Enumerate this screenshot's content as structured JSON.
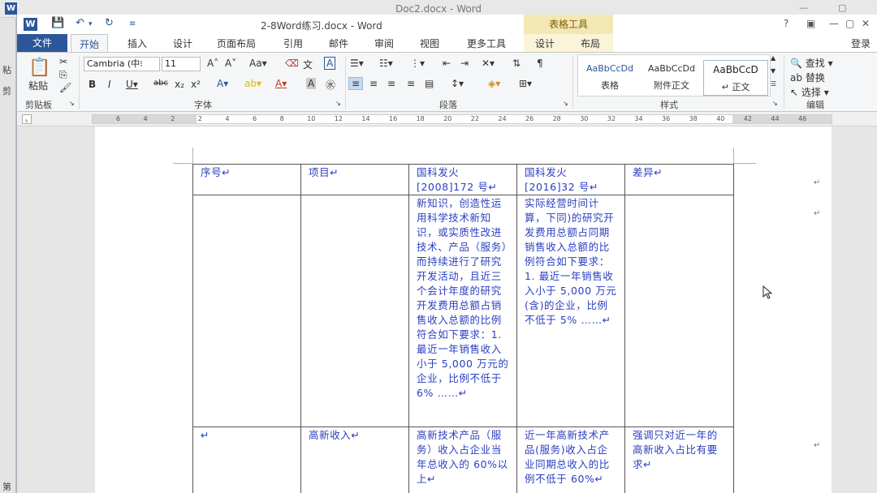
{
  "background_window": {
    "title": "Doc2.docx - Word",
    "logo": "W",
    "left_strip_chars": [
      "粘",
      "剪",
      "第"
    ]
  },
  "window": {
    "title": "2-8Word练习.docx - Word",
    "logo": "W",
    "context_tab_group": "表格工具",
    "controls": [
      "?",
      "▣",
      "—",
      "▢",
      "✕"
    ],
    "login": "登录"
  },
  "tabs": [
    {
      "label": "文件",
      "type": "file"
    },
    {
      "label": "开始",
      "type": "active"
    },
    {
      "label": "插入"
    },
    {
      "label": "设计"
    },
    {
      "label": "页面布局"
    },
    {
      "label": "引用"
    },
    {
      "label": "邮件"
    },
    {
      "label": "审阅"
    },
    {
      "label": "视图"
    },
    {
      "label": "更多工具"
    },
    {
      "label": "设计",
      "type": "context"
    },
    {
      "label": "布局",
      "type": "context"
    }
  ],
  "ribbon": {
    "clipboard": {
      "paste_label": "粘贴",
      "group_label": "剪贴板"
    },
    "font": {
      "font_name": "Cambria (中⁝",
      "font_size": "11",
      "group_label": "字体"
    },
    "paragraph": {
      "group_label": "段落"
    },
    "styles": {
      "group_label": "样式",
      "items": [
        {
          "sample": "AaBbCcDd",
          "name": "表格"
        },
        {
          "sample": "AaBbCcDd",
          "name": "附件正文"
        },
        {
          "sample": "AaBbCcD",
          "name": "↵ 正文"
        }
      ]
    },
    "editing": {
      "group_label": "编辑",
      "find": "查找",
      "replace": "替换",
      "select": "选择"
    }
  },
  "ruler": {
    "ticks": [
      "6",
      "4",
      "2",
      "2",
      "4",
      "6",
      "8",
      "10",
      "12",
      "14",
      "16",
      "18",
      "20",
      "22",
      "24",
      "26",
      "28",
      "30",
      "32",
      "34",
      "36",
      "38",
      "40",
      "42",
      "44",
      "46"
    ]
  },
  "table": {
    "header": [
      "序号↵",
      "项目↵",
      "国科发火 [2008]172 号↵",
      "国科发火 [2016]32 号↵",
      "差异↵"
    ],
    "rows": [
      [
        "",
        "",
        "新知识，创造性运用科学技术新知识，或实质性改进技术、产品（服务）而持续进行了研究开发活动，且近三个会计年度的研究开发费用总额占销售收入总额的比例符合如下要求：1. 最近一年销售收入小于 5,000 万元的企业，比例不低于 6% ……↵",
        "实际经营时间计算，下同)的研究开发费用总额占同期销售收入总额的比例符合如下要求：1. 最近一年销售收入小于 5,000 万元(含)的企业，比例不低于 5% ……↵",
        ""
      ],
      [
        "↵",
        "高新收入↵",
        "高新技术产品（服务）收入占企业当年总收入的 60%以上↵",
        "近一年高新技术产品(服务)收入占企业同期总收入的比例不低于 60%↵",
        "强调只对近一年的高新收入占比有要求↵"
      ]
    ],
    "end_of_row_mark": "↵"
  }
}
